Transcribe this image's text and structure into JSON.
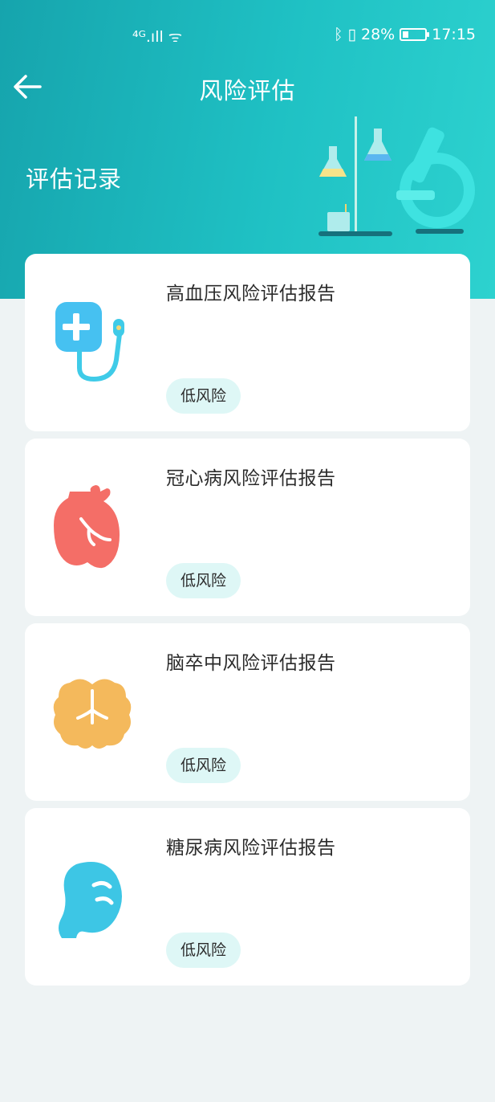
{
  "status_bar": {
    "network": "⁴ᴳ.ıll ᯤ",
    "bluetooth": "ᛒ",
    "vibrate": "▯",
    "battery": "28%",
    "time": "17:15"
  },
  "nav": {
    "title": "风险评估",
    "back_icon": "arrow-left-icon"
  },
  "section": {
    "title": "评估记录"
  },
  "reports": [
    {
      "title": "高血压风险评估报告",
      "risk": "低风险",
      "icon": "blood-pressure-icon"
    },
    {
      "title": "冠心病风险评估报告",
      "risk": "低风险",
      "icon": "heart-icon"
    },
    {
      "title": "脑卒中风险评估报告",
      "risk": "低风险",
      "icon": "brain-icon"
    },
    {
      "title": "糖尿病风险评估报告",
      "risk": "低风险",
      "icon": "pancreas-icon"
    }
  ],
  "colors": {
    "header_start": "#16a4ad",
    "header_end": "#2dd2cf",
    "badge_bg": "#def7f6",
    "page_bg": "#eef3f4"
  }
}
